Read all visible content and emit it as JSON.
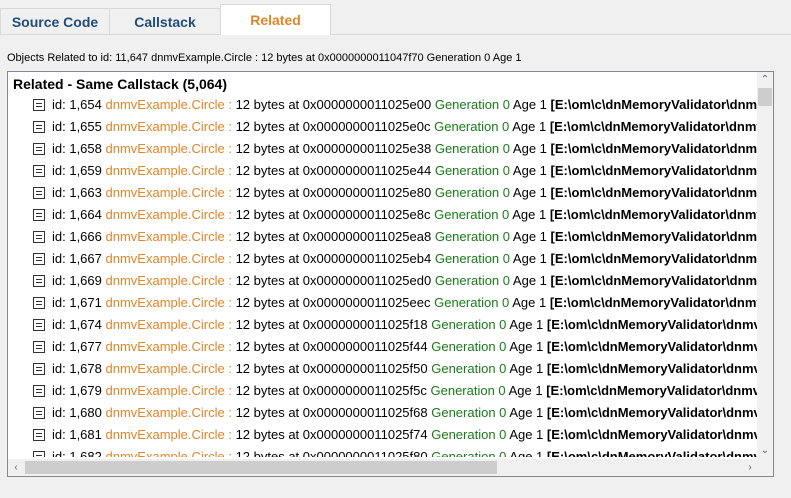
{
  "tabs": [
    {
      "label": "Source Code",
      "active": false
    },
    {
      "label": "Callstack",
      "active": false
    },
    {
      "label": "Related",
      "active": true
    }
  ],
  "info_line": "Objects Related to id: 11,647 dnmvExample.Circle : 12 bytes at 0x0000000011047f70 Generation 0 Age 1",
  "tree": {
    "header": "Related - Same Callstack (5,064)",
    "rows": [
      {
        "id": "id: 1,654",
        "type": "dnmvExample.Circle :",
        "bytes": "12 bytes at 0x0000000011025e00",
        "gen": "Generation 0",
        "age": "Age 1",
        "path": "[E:\\om\\c\\dnMemoryValidator\\dnmvExample\\For"
      },
      {
        "id": "id: 1,655",
        "type": "dnmvExample.Circle :",
        "bytes": "12 bytes at 0x0000000011025e0c",
        "gen": "Generation 0",
        "age": "Age 1",
        "path": "[E:\\om\\c\\dnMemoryValidator\\dnmvExample\\For"
      },
      {
        "id": "id: 1,658",
        "type": "dnmvExample.Circle :",
        "bytes": "12 bytes at 0x0000000011025e38",
        "gen": "Generation 0",
        "age": "Age 1",
        "path": "[E:\\om\\c\\dnMemoryValidator\\dnmvExample\\For"
      },
      {
        "id": "id: 1,659",
        "type": "dnmvExample.Circle :",
        "bytes": "12 bytes at 0x0000000011025e44",
        "gen": "Generation 0",
        "age": "Age 1",
        "path": "[E:\\om\\c\\dnMemoryValidator\\dnmvExample\\For"
      },
      {
        "id": "id: 1,663",
        "type": "dnmvExample.Circle :",
        "bytes": "12 bytes at 0x0000000011025e80",
        "gen": "Generation 0",
        "age": "Age 1",
        "path": "[E:\\om\\c\\dnMemoryValidator\\dnmvExample\\For"
      },
      {
        "id": "id: 1,664",
        "type": "dnmvExample.Circle :",
        "bytes": "12 bytes at 0x0000000011025e8c",
        "gen": "Generation 0",
        "age": "Age 1",
        "path": "[E:\\om\\c\\dnMemoryValidator\\dnmvExample\\For"
      },
      {
        "id": "id: 1,666",
        "type": "dnmvExample.Circle :",
        "bytes": "12 bytes at 0x0000000011025ea8",
        "gen": "Generation 0",
        "age": "Age 1",
        "path": "[E:\\om\\c\\dnMemoryValidator\\dnmvExample\\For"
      },
      {
        "id": "id: 1,667",
        "type": "dnmvExample.Circle :",
        "bytes": "12 bytes at 0x0000000011025eb4",
        "gen": "Generation 0",
        "age": "Age 1",
        "path": "[E:\\om\\c\\dnMemoryValidator\\dnmvExample\\For"
      },
      {
        "id": "id: 1,669",
        "type": "dnmvExample.Circle :",
        "bytes": "12 bytes at 0x0000000011025ed0",
        "gen": "Generation 0",
        "age": "Age 1",
        "path": "[E:\\om\\c\\dnMemoryValidator\\dnmvExample\\For"
      },
      {
        "id": "id: 1,671",
        "type": "dnmvExample.Circle :",
        "bytes": "12 bytes at 0x0000000011025eec",
        "gen": "Generation 0",
        "age": "Age 1",
        "path": "[E:\\om\\c\\dnMemoryValidator\\dnmvExample\\For"
      },
      {
        "id": "id: 1,674",
        "type": "dnmvExample.Circle :",
        "bytes": "12 bytes at 0x0000000011025f18",
        "gen": "Generation 0",
        "age": "Age 1",
        "path": "[E:\\om\\c\\dnMemoryValidator\\dnmvExample\\For"
      },
      {
        "id": "id: 1,677",
        "type": "dnmvExample.Circle :",
        "bytes": "12 bytes at 0x0000000011025f44",
        "gen": "Generation 0",
        "age": "Age 1",
        "path": "[E:\\om\\c\\dnMemoryValidator\\dnmvExample\\For"
      },
      {
        "id": "id: 1,678",
        "type": "dnmvExample.Circle :",
        "bytes": "12 bytes at 0x0000000011025f50",
        "gen": "Generation 0",
        "age": "Age 1",
        "path": "[E:\\om\\c\\dnMemoryValidator\\dnmvExample\\For"
      },
      {
        "id": "id: 1,679",
        "type": "dnmvExample.Circle :",
        "bytes": "12 bytes at 0x0000000011025f5c",
        "gen": "Generation 0",
        "age": "Age 1",
        "path": "[E:\\om\\c\\dnMemoryValidator\\dnmvExample\\For"
      },
      {
        "id": "id: 1,680",
        "type": "dnmvExample.Circle :",
        "bytes": "12 bytes at 0x0000000011025f68",
        "gen": "Generation 0",
        "age": "Age 1",
        "path": "[E:\\om\\c\\dnMemoryValidator\\dnmvExample\\For"
      },
      {
        "id": "id: 1,681",
        "type": "dnmvExample.Circle :",
        "bytes": "12 bytes at 0x0000000011025f74",
        "gen": "Generation 0",
        "age": "Age 1",
        "path": "[E:\\om\\c\\dnMemoryValidator\\dnmvExample\\For"
      },
      {
        "id": "id: 1,682",
        "type": "dnmvExample.Circle :",
        "bytes": "12 bytes at 0x0000000011025f80",
        "gen": "Generation 0",
        "age": "Age 1",
        "path": "[E:\\om\\c\\dnMemoryValidator\\dnmvExample\\For"
      }
    ]
  },
  "icons": {
    "row_icon": "object-item-icon",
    "scroll_up": "scroll-up-arrow-icon",
    "scroll_down": "scroll-down-arrow-icon",
    "scroll_left": "scroll-left-arrow-icon",
    "scroll_right": "scroll-right-arrow-icon"
  },
  "colors": {
    "active_tab": "#e0852a",
    "inactive_tab": "#1f4e79",
    "type_text": "#e0852a",
    "generation_text": "#1a7a1a"
  }
}
